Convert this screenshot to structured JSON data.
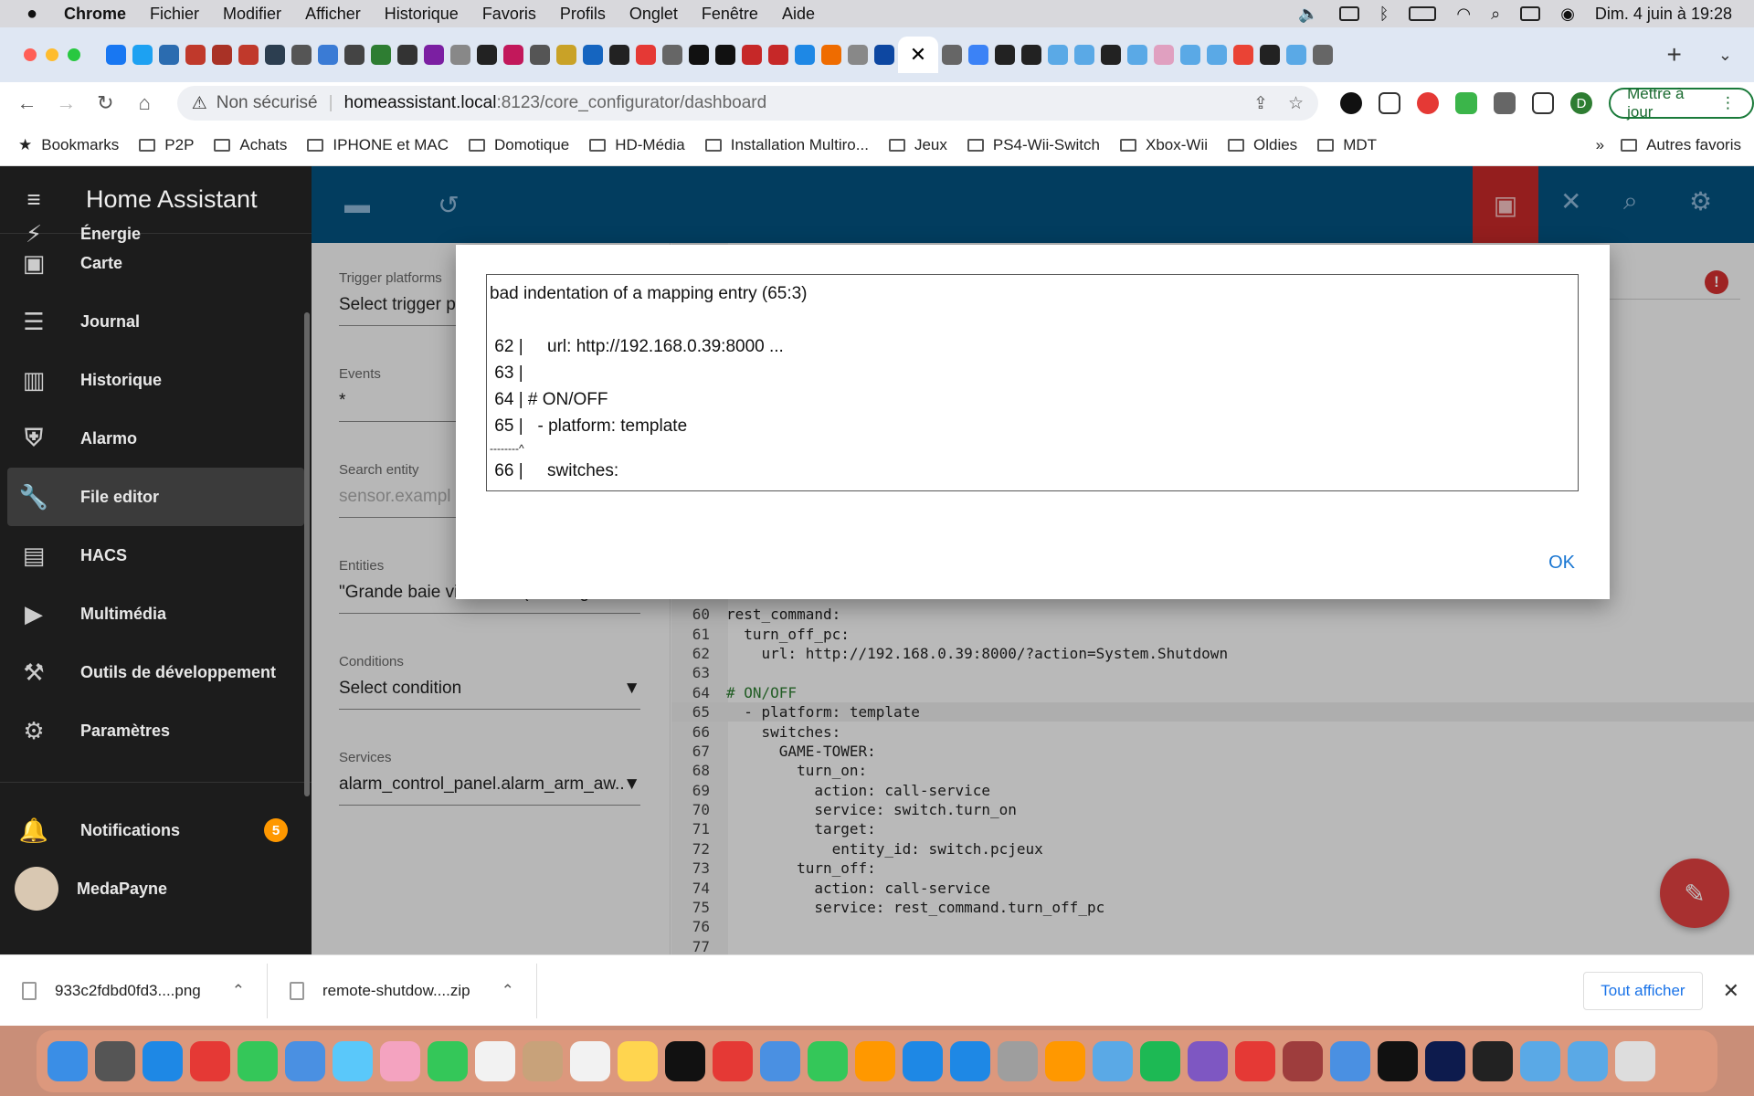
{
  "menubar": {
    "browser": "Chrome",
    "items": [
      "Fichier",
      "Modifier",
      "Afficher",
      "Historique",
      "Favoris",
      "Profils",
      "Onglet",
      "Fenêtre",
      "Aide"
    ],
    "datetime": "Dim. 4 juin à 19:28"
  },
  "tabs": {
    "active_icon": "✕",
    "new_tab": "+"
  },
  "toolbar": {
    "security": "Non sécurisé",
    "host": "homeassistant.local",
    "path": ":8123/core_configurator/dashboard",
    "update_button": "Mettre à jour",
    "profile_initial": "D"
  },
  "bookmarks": {
    "items": [
      "Bookmarks",
      "P2P",
      "Achats",
      "IPHONE et MAC",
      "Domotique",
      "HD-Média",
      "Installation Multiro...",
      "Jeux",
      "PS4-Wii-Switch",
      "Xbox-Wii",
      "Oldies",
      "MDT"
    ],
    "more": "»",
    "other": "Autres favoris"
  },
  "sidebar": {
    "title": "Home Assistant",
    "items": [
      {
        "label": "Énergie",
        "icon": "⚡"
      },
      {
        "label": "Carte",
        "icon": "▣"
      },
      {
        "label": "Journal",
        "icon": "☰"
      },
      {
        "label": "Historique",
        "icon": "▥"
      },
      {
        "label": "Alarmo",
        "icon": "⛨"
      },
      {
        "label": "File editor",
        "icon": "🔧"
      },
      {
        "label": "HACS",
        "icon": "▤"
      },
      {
        "label": "Multimédia",
        "icon": "▶"
      },
      {
        "label": "Outils de développement",
        "icon": "⚒"
      },
      {
        "label": "Paramètres",
        "icon": "⚙"
      }
    ],
    "notifications": {
      "label": "Notifications",
      "count": "5"
    },
    "user": {
      "name": "MedaPayne"
    }
  },
  "panel": {
    "trigger_label": "Trigger platforms",
    "trigger_value": "Select trigger p",
    "events_label": "Events",
    "events_value": "*",
    "search_label": "Search entity",
    "search_placeholder": "sensor.exampl",
    "entities_label": "Entities",
    "entities_value": "\"Grande baie vitree\" off (scene.gran...",
    "conditions_label": "Conditions",
    "conditions_value": "Select condition",
    "services_label": "Services",
    "services_value": "alarm_control_panel.alarm_arm_aw...",
    "caret": "▼"
  },
  "code": [
    {
      "n": "60",
      "t": "rest_command:"
    },
    {
      "n": "61",
      "t": "  turn_off_pc:"
    },
    {
      "n": "62",
      "t": "    url: http://192.168.0.39:8000/?action=System.Shutdown"
    },
    {
      "n": "63",
      "t": ""
    },
    {
      "n": "64",
      "t": "# ON/OFF"
    },
    {
      "n": "65",
      "t": "  - platform: template"
    },
    {
      "n": "66",
      "t": "    switches:"
    },
    {
      "n": "67",
      "t": "      GAME-TOWER:"
    },
    {
      "n": "68",
      "t": "        turn_on:"
    },
    {
      "n": "69",
      "t": "          action: call-service"
    },
    {
      "n": "70",
      "t": "          service: switch.turn_on"
    },
    {
      "n": "71",
      "t": "          target:"
    },
    {
      "n": "72",
      "t": "            entity_id: switch.pcjeux"
    },
    {
      "n": "73",
      "t": "        turn_off:"
    },
    {
      "n": "74",
      "t": "          action: call-service"
    },
    {
      "n": "75",
      "t": "          service: rest_command.turn_off_pc"
    },
    {
      "n": "76",
      "t": ""
    },
    {
      "n": "77",
      "t": ""
    }
  ],
  "error_badge": "!",
  "dialog": {
    "lines": [
      "bad indentation of a mapping entry (65:3)",
      "",
      " 62 |     url: http://192.168.0.39:8000 ...",
      " 63 |",
      " 64 | # ON/OFF",
      " 65 |   - platform: template",
      "--------^",
      " 66 |     switches:"
    ],
    "ok": "OK"
  },
  "downloads": {
    "items": [
      "933c2fdbd0fd3....png",
      "remote-shutdow....zip"
    ],
    "show_all": "Tout afficher",
    "close": "✕"
  }
}
